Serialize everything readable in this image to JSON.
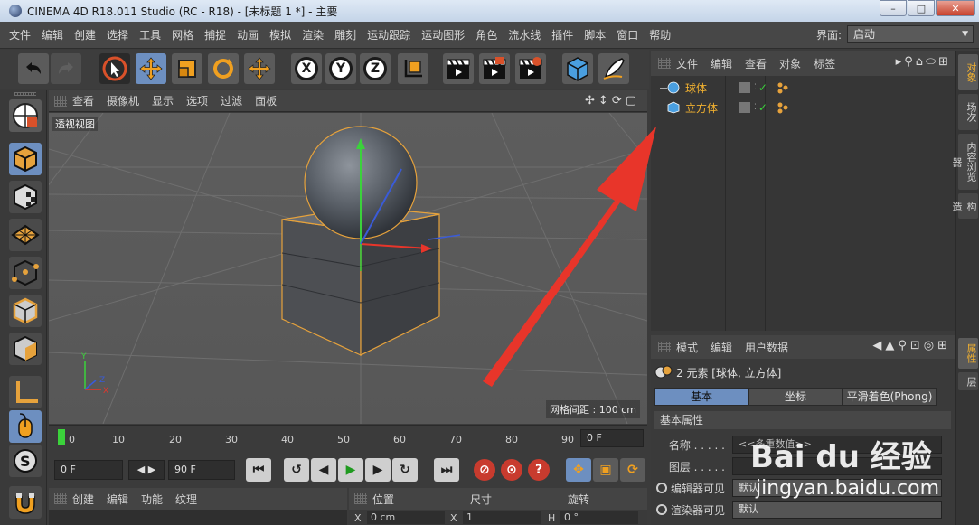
{
  "window": {
    "title": "CINEMA 4D R18.011 Studio (RC - R18) - [未标题 1 *] - 主要",
    "min": "–",
    "max": "□",
    "close": "✕"
  },
  "menu": [
    "文件",
    "编辑",
    "创建",
    "选择",
    "工具",
    "网格",
    "捕捉",
    "动画",
    "模拟",
    "渲染",
    "雕刻",
    "运动跟踪",
    "运动图形",
    "角色",
    "流水线",
    "插件",
    "脚本",
    "窗口",
    "帮助"
  ],
  "layout": {
    "label": "界面:",
    "value": "启动"
  },
  "viewport": {
    "menu": [
      "查看",
      "摄像机",
      "显示",
      "选项",
      "过滤",
      "面板"
    ],
    "view_label": "透视视图",
    "grid_spacing": "网格间距 : 100 cm",
    "nav_icons": "✢↕⟳▢",
    "axis": {
      "x": "X",
      "y": "Y",
      "z": "Z"
    }
  },
  "timeline": {
    "ticks": [
      "0",
      "10",
      "20",
      "30",
      "40",
      "50",
      "60",
      "70",
      "80",
      "90"
    ],
    "current_frame": "0 F"
  },
  "transport": {
    "start": "0 F",
    "end": "90 F",
    "toggle": "◀ ▶"
  },
  "material_panel": {
    "menu": [
      "创建",
      "编辑",
      "功能",
      "纹理"
    ]
  },
  "coord_panel": {
    "headers": [
      "位置",
      "尺寸",
      "旋转"
    ],
    "row": {
      "x_label": "X",
      "x_value": "0 cm",
      "s_label": "X",
      "s_value": "1",
      "r_label": "H",
      "r_value": "0 °"
    }
  },
  "object_manager": {
    "menu": [
      "文件",
      "编辑",
      "查看",
      "对象",
      "标签"
    ],
    "objects": [
      {
        "name": "球体",
        "check": "✓"
      },
      {
        "name": "立方体",
        "check": "✓"
      }
    ]
  },
  "attribute_manager": {
    "menu": [
      "模式",
      "编辑",
      "用户数据"
    ],
    "selection": "2 元素 [球体, 立方体]",
    "tabs": [
      "基本",
      "坐标",
      "平滑着色(Phong)"
    ],
    "section": "基本属性",
    "fields": [
      {
        "label": "名称 . . . . .",
        "value": "<<多重数值>>"
      },
      {
        "label": "图层 . . . . .",
        "value": ""
      },
      {
        "label": "编辑器可见",
        "value": "默认"
      },
      {
        "label": "渲染器可见",
        "value": "默认"
      }
    ]
  },
  "side_tabs": [
    "对象",
    "场次",
    "内容浏览器",
    "构造"
  ],
  "attr_side_tabs": [
    "属性",
    "层"
  ],
  "watermark": {
    "logo": "Bai du 经验",
    "url": "jingyan.baidu.com"
  },
  "colors": {
    "accent": "#6d8fc0",
    "object_name": "#f0b030",
    "arrow": "#e8352a",
    "play": "#3bd23b"
  }
}
